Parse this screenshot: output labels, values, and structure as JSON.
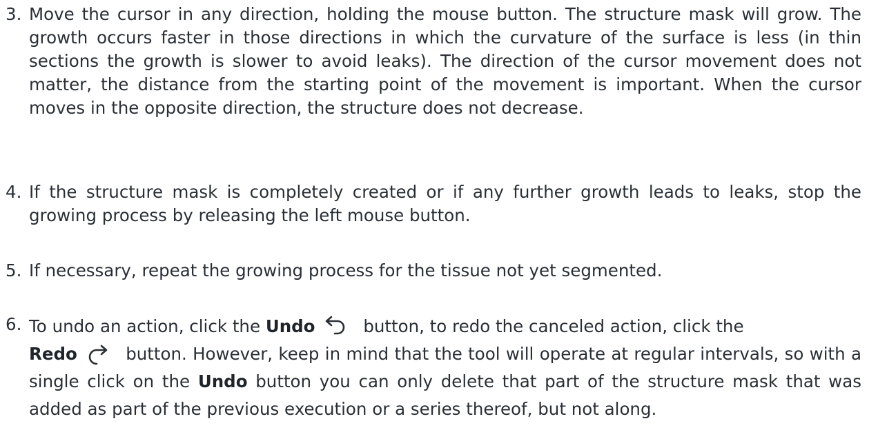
{
  "steps": [
    {
      "number": "3.",
      "text": "Move the cursor in any direction, holding the mouse button.  The structure mask will grow. The growth occurs faster in those directions in which the curvature of the surface is less (in thin sections the growth is slower to avoid leaks). The direction of the cursor movement does not matter, the distance from the starting point of the movement is important.  When the cursor moves in the opposite direction, the structure does not decrease."
    },
    {
      "number": "4.",
      "text": "If the structure mask is completely created or if any further growth leads to leaks, stop the growing process by releasing the left mouse button."
    },
    {
      "number": "5.",
      "text": "If necessary, repeat the growing process for the tissue not yet segmented."
    },
    {
      "number": "6.",
      "part1": "To undo an action, click the ",
      "undo_label": "Undo",
      "part2": " button, to redo the canceled action, click the",
      "redo_label": "Redo",
      "part3": " button. However, keep in mind that the tool will operate at regular intervals, so with a single click on the ",
      "undo_label_2": "Undo",
      "part4": " button you can only delete that part of the structure mask that was added as part of the previous execution or a series thereof, but not along."
    }
  ],
  "icons": {
    "undo": "undo-arrow-icon",
    "redo": "redo-arrow-icon"
  }
}
